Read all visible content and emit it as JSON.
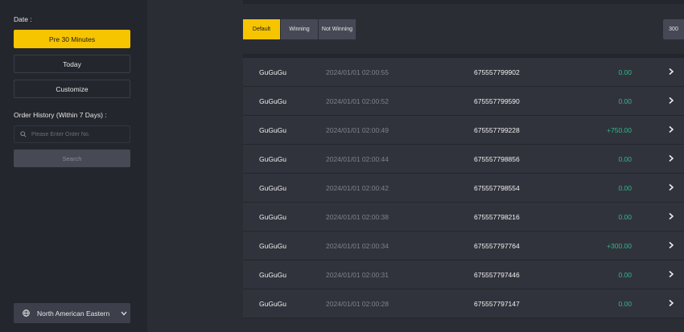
{
  "sidebar": {
    "date_label": "Date :",
    "date_buttons": [
      "Pre 30 Minutes",
      "Today",
      "Customize"
    ],
    "history_label": "Order History (Within 7 Days) :",
    "search_placeholder": "Please Enter Order No.",
    "search_button": "Search",
    "region": "North American Eastern"
  },
  "tabs": [
    "Default",
    "Winning",
    "Not Winning"
  ],
  "count_button": "300",
  "orders": [
    {
      "game": "GuGuGu",
      "time": "2024/01/01 02:00:55",
      "order_no": "675557799902",
      "amount": "0.00"
    },
    {
      "game": "GuGuGu",
      "time": "2024/01/01 02:00:52",
      "order_no": "675557799590",
      "amount": "0.00"
    },
    {
      "game": "GuGuGu",
      "time": "2024/01/01 02:00:49",
      "order_no": "675557799228",
      "amount": "+750.00"
    },
    {
      "game": "GuGuGu",
      "time": "2024/01/01 02:00:44",
      "order_no": "675557798856",
      "amount": "0.00"
    },
    {
      "game": "GuGuGu",
      "time": "2024/01/01 02:00:42",
      "order_no": "675557798554",
      "amount": "0.00"
    },
    {
      "game": "GuGuGu",
      "time": "2024/01/01 02:00:38",
      "order_no": "675557798216",
      "amount": "0.00"
    },
    {
      "game": "GuGuGu",
      "time": "2024/01/01 02:00:34",
      "order_no": "675557797764",
      "amount": "+300.00"
    },
    {
      "game": "GuGuGu",
      "time": "2024/01/01 02:00:31",
      "order_no": "675557797446",
      "amount": "0.00"
    },
    {
      "game": "GuGuGu",
      "time": "2024/01/01 02:00:28",
      "order_no": "675557797147",
      "amount": "0.00"
    }
  ],
  "colors": {
    "accent": "#f7c400",
    "positive": "#2fb98a",
    "sidebar_bg": "#24262d",
    "row_bg": "#31333c"
  }
}
